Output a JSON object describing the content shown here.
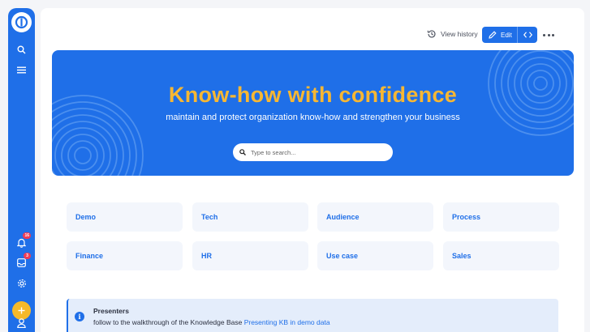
{
  "sidebar": {
    "notifications_count": "16",
    "inbox_count": "3"
  },
  "toolbar": {
    "history_label": "View history",
    "edit_label": "Edit"
  },
  "hero": {
    "title": "Know-how with confidence",
    "subtitle": "maintain and protect organization know-how and strengthen your business",
    "search_placeholder": "Type to search..."
  },
  "categories": [
    {
      "label": "Demo"
    },
    {
      "label": "Tech"
    },
    {
      "label": "Audience"
    },
    {
      "label": "Process"
    },
    {
      "label": "Finance"
    },
    {
      "label": "HR"
    },
    {
      "label": "Use case"
    },
    {
      "label": "Sales"
    }
  ],
  "info": {
    "title": "Presenters",
    "text": "follow to the walkthrough of the Knowledge Base ",
    "link": "Presenting KB in demo data"
  },
  "colors": {
    "accent": "#1f6fe8",
    "hero_title": "#f7b733",
    "add_button": "#f5b92a",
    "badge": "#ef3b55"
  },
  "icons": [
    "logo-icon",
    "search-icon",
    "menu-icon",
    "bell-icon",
    "inbox-icon",
    "settings-icon",
    "plus-icon",
    "user-icon",
    "history-icon",
    "pencil-icon",
    "code-icon",
    "more-icon",
    "info-icon"
  ]
}
